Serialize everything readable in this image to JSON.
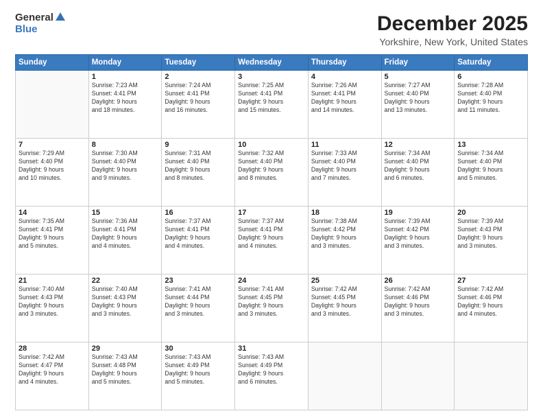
{
  "header": {
    "logo_general": "General",
    "logo_blue": "Blue",
    "title": "December 2025",
    "location": "Yorkshire, New York, United States"
  },
  "columns": [
    "Sunday",
    "Monday",
    "Tuesday",
    "Wednesday",
    "Thursday",
    "Friday",
    "Saturday"
  ],
  "weeks": [
    [
      {
        "day": "",
        "info": ""
      },
      {
        "day": "1",
        "info": "Sunrise: 7:23 AM\nSunset: 4:41 PM\nDaylight: 9 hours\nand 18 minutes."
      },
      {
        "day": "2",
        "info": "Sunrise: 7:24 AM\nSunset: 4:41 PM\nDaylight: 9 hours\nand 16 minutes."
      },
      {
        "day": "3",
        "info": "Sunrise: 7:25 AM\nSunset: 4:41 PM\nDaylight: 9 hours\nand 15 minutes."
      },
      {
        "day": "4",
        "info": "Sunrise: 7:26 AM\nSunset: 4:41 PM\nDaylight: 9 hours\nand 14 minutes."
      },
      {
        "day": "5",
        "info": "Sunrise: 7:27 AM\nSunset: 4:40 PM\nDaylight: 9 hours\nand 13 minutes."
      },
      {
        "day": "6",
        "info": "Sunrise: 7:28 AM\nSunset: 4:40 PM\nDaylight: 9 hours\nand 11 minutes."
      }
    ],
    [
      {
        "day": "7",
        "info": "Sunrise: 7:29 AM\nSunset: 4:40 PM\nDaylight: 9 hours\nand 10 minutes."
      },
      {
        "day": "8",
        "info": "Sunrise: 7:30 AM\nSunset: 4:40 PM\nDaylight: 9 hours\nand 9 minutes."
      },
      {
        "day": "9",
        "info": "Sunrise: 7:31 AM\nSunset: 4:40 PM\nDaylight: 9 hours\nand 8 minutes."
      },
      {
        "day": "10",
        "info": "Sunrise: 7:32 AM\nSunset: 4:40 PM\nDaylight: 9 hours\nand 8 minutes."
      },
      {
        "day": "11",
        "info": "Sunrise: 7:33 AM\nSunset: 4:40 PM\nDaylight: 9 hours\nand 7 minutes."
      },
      {
        "day": "12",
        "info": "Sunrise: 7:34 AM\nSunset: 4:40 PM\nDaylight: 9 hours\nand 6 minutes."
      },
      {
        "day": "13",
        "info": "Sunrise: 7:34 AM\nSunset: 4:40 PM\nDaylight: 9 hours\nand 5 minutes."
      }
    ],
    [
      {
        "day": "14",
        "info": "Sunrise: 7:35 AM\nSunset: 4:41 PM\nDaylight: 9 hours\nand 5 minutes."
      },
      {
        "day": "15",
        "info": "Sunrise: 7:36 AM\nSunset: 4:41 PM\nDaylight: 9 hours\nand 4 minutes."
      },
      {
        "day": "16",
        "info": "Sunrise: 7:37 AM\nSunset: 4:41 PM\nDaylight: 9 hours\nand 4 minutes."
      },
      {
        "day": "17",
        "info": "Sunrise: 7:37 AM\nSunset: 4:41 PM\nDaylight: 9 hours\nand 4 minutes."
      },
      {
        "day": "18",
        "info": "Sunrise: 7:38 AM\nSunset: 4:42 PM\nDaylight: 9 hours\nand 3 minutes."
      },
      {
        "day": "19",
        "info": "Sunrise: 7:39 AM\nSunset: 4:42 PM\nDaylight: 9 hours\nand 3 minutes."
      },
      {
        "day": "20",
        "info": "Sunrise: 7:39 AM\nSunset: 4:43 PM\nDaylight: 9 hours\nand 3 minutes."
      }
    ],
    [
      {
        "day": "21",
        "info": "Sunrise: 7:40 AM\nSunset: 4:43 PM\nDaylight: 9 hours\nand 3 minutes."
      },
      {
        "day": "22",
        "info": "Sunrise: 7:40 AM\nSunset: 4:43 PM\nDaylight: 9 hours\nand 3 minutes."
      },
      {
        "day": "23",
        "info": "Sunrise: 7:41 AM\nSunset: 4:44 PM\nDaylight: 9 hours\nand 3 minutes."
      },
      {
        "day": "24",
        "info": "Sunrise: 7:41 AM\nSunset: 4:45 PM\nDaylight: 9 hours\nand 3 minutes."
      },
      {
        "day": "25",
        "info": "Sunrise: 7:42 AM\nSunset: 4:45 PM\nDaylight: 9 hours\nand 3 minutes."
      },
      {
        "day": "26",
        "info": "Sunrise: 7:42 AM\nSunset: 4:46 PM\nDaylight: 9 hours\nand 3 minutes."
      },
      {
        "day": "27",
        "info": "Sunrise: 7:42 AM\nSunset: 4:46 PM\nDaylight: 9 hours\nand 4 minutes."
      }
    ],
    [
      {
        "day": "28",
        "info": "Sunrise: 7:42 AM\nSunset: 4:47 PM\nDaylight: 9 hours\nand 4 minutes."
      },
      {
        "day": "29",
        "info": "Sunrise: 7:43 AM\nSunset: 4:48 PM\nDaylight: 9 hours\nand 5 minutes."
      },
      {
        "day": "30",
        "info": "Sunrise: 7:43 AM\nSunset: 4:49 PM\nDaylight: 9 hours\nand 5 minutes."
      },
      {
        "day": "31",
        "info": "Sunrise: 7:43 AM\nSunset: 4:49 PM\nDaylight: 9 hours\nand 6 minutes."
      },
      {
        "day": "",
        "info": ""
      },
      {
        "day": "",
        "info": ""
      },
      {
        "day": "",
        "info": ""
      }
    ]
  ]
}
